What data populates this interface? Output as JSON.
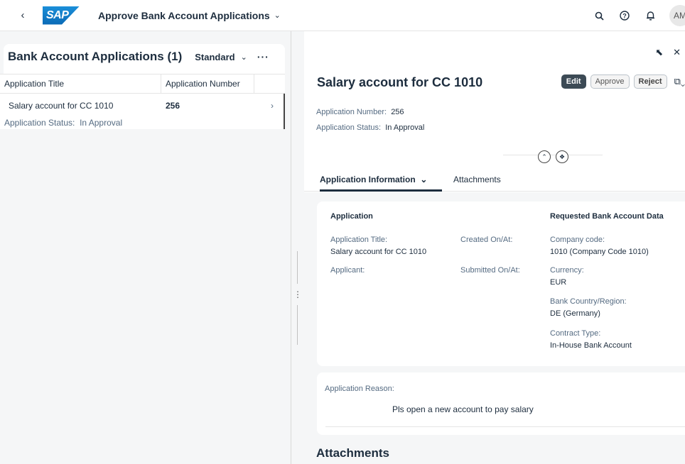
{
  "shell": {
    "app_title": "Approve Bank Account Applications",
    "logo_text": "SAP",
    "avatar_initials": "AM",
    "icons": [
      "back-icon",
      "search-icon",
      "help-icon",
      "bell-icon"
    ]
  },
  "list": {
    "title": "Bank Account Applications (1)",
    "variant": "Standard",
    "columns": [
      "Application Title",
      "Application Number"
    ],
    "rows": [
      {
        "title": "Salary account for CC 1010",
        "number": "256",
        "status_label": "Application Status:",
        "status": "In Approval"
      }
    ]
  },
  "detail": {
    "title": "Salary account for CC 1010",
    "actions": {
      "edit": "Edit",
      "approve": "Approve",
      "reject": "Reject"
    },
    "header_fields": [
      {
        "label": "Application Number:",
        "value": "256"
      },
      {
        "label": "Application Status:",
        "value": "In Approval"
      }
    ],
    "tabs": [
      "Application Information",
      "Attachments"
    ],
    "sections": {
      "application": {
        "title": "Application",
        "app_title_label": "Application Title:",
        "app_title_value": "Salary account for CC 1010",
        "created_label": "Created On/At:",
        "applicant_label": "Applicant:",
        "submitted_label": "Submitted On/At:"
      },
      "requested": {
        "title": "Requested Bank Account Data",
        "fields": [
          {
            "label": "Company code:",
            "value": "1010 (Company Code 1010)"
          },
          {
            "label": "Currency:",
            "value": "EUR"
          },
          {
            "label": "Bank Country/Region:",
            "value": "DE (Germany)"
          },
          {
            "label": "Contract Type:",
            "value": "In-House Bank Account"
          }
        ]
      },
      "reason": {
        "label": "Application Reason:",
        "value": "Pls open a new account to pay salary"
      },
      "attachments_title": "Attachments"
    }
  },
  "colors": {
    "text": "#1d2d3e",
    "secondary": "#556b82",
    "bg": "#f5f6f7",
    "edit_btn": "#3c4a55"
  }
}
